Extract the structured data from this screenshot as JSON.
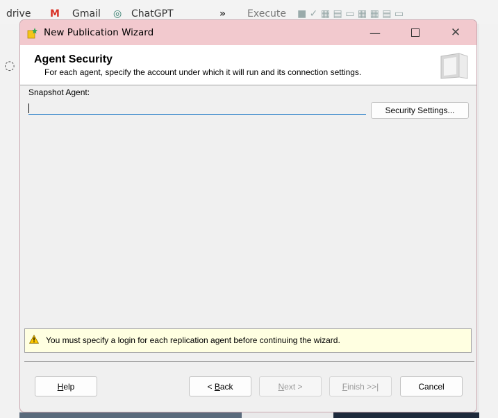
{
  "background": {
    "bookmarks": [
      "drive",
      "Gmail",
      "ChatGPT",
      "»",
      "Execute"
    ]
  },
  "window": {
    "title": "New Publication Wizard",
    "controls": {
      "minimize": "—",
      "close": "✕"
    }
  },
  "header": {
    "title": "Agent Security",
    "subtitle": "For each agent, specify the account under which it will run and its connection settings."
  },
  "snapshot_agent": {
    "label": "Snapshot Agent:",
    "value": "",
    "security_button": "Security Settings..."
  },
  "warning": {
    "icon": "warning-icon",
    "text": "You must specify a login for each replication agent before continuing the wizard."
  },
  "buttons": {
    "help": {
      "mnemonic": "H",
      "rest": "elp",
      "enabled": true
    },
    "back": {
      "prefix": "< ",
      "mnemonic": "B",
      "rest": "ack",
      "enabled": true
    },
    "next": {
      "mnemonic": "N",
      "rest": "ext >",
      "enabled": false
    },
    "finish": {
      "mnemonic": "F",
      "rest": "inish >>|",
      "enabled": false
    },
    "cancel": {
      "label": "Cancel",
      "enabled": true
    }
  },
  "colors": {
    "titlebar": "#f2c9ce",
    "input_underline": "#0067c0",
    "warning_bg": "#ffffe1"
  }
}
